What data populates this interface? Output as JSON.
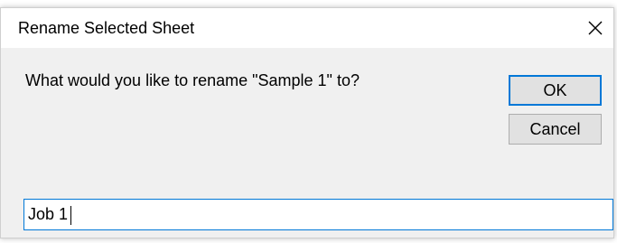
{
  "dialog": {
    "title": "Rename Selected Sheet",
    "prompt": "What would you like to rename \"Sample 1\" to?",
    "ok_label": "OK",
    "cancel_label": "Cancel",
    "input_value": "Job 1",
    "accent_color": "#0078d7",
    "background_color": "#f0f0f0",
    "close_icon": "close-icon"
  }
}
